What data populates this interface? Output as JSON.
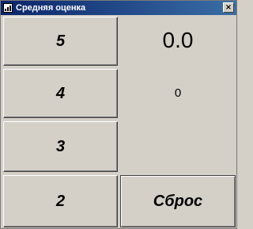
{
  "window": {
    "title": "Средняя оценка",
    "close_glyph": "×",
    "icon": "chart-icon",
    "title_bar_color": "#0a246a",
    "face_color": "#d4d0c8"
  },
  "grades": {
    "five": "5",
    "four": "4",
    "three": "3",
    "two": "2"
  },
  "display": {
    "average": "0.0",
    "count": "0"
  },
  "controls": {
    "reset_label": "Сброс"
  }
}
